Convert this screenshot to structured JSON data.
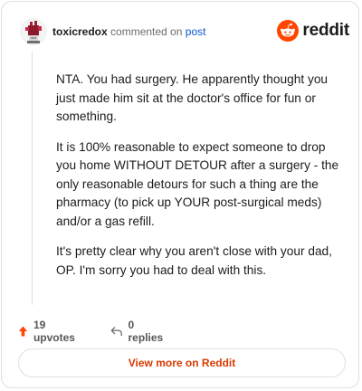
{
  "comment": {
    "username": "toxicredox",
    "action_text": "commented on",
    "post_link": "post",
    "brand": "reddit",
    "paragraphs": [
      "NTA. You had surgery. He apparently thought you just made him sit at the doctor's office for fun or something.",
      "It is 100% reasonable to expect someone to drop you home WITHOUT DETOUR after a surgery - the only reasonable detours for such a thing are the pharmacy (to pick up YOUR post-surgical meds) and/or a gas refill.",
      "It's pretty clear why you aren't close with your dad, OP. I'm sorry you had to deal with this."
    ]
  },
  "actions": {
    "upvotes": "19 upvotes",
    "replies": "0 replies"
  },
  "footer": {
    "view_more": "View more on Reddit"
  },
  "colors": {
    "brand_orange": "#ff4500",
    "upvote": "#ff4500",
    "link": "#0b57d0",
    "button_text": "#d93a00"
  },
  "icons": [
    "avatar",
    "reddit-logo-icon",
    "upvote-arrow-icon",
    "reply-arrow-icon"
  ]
}
